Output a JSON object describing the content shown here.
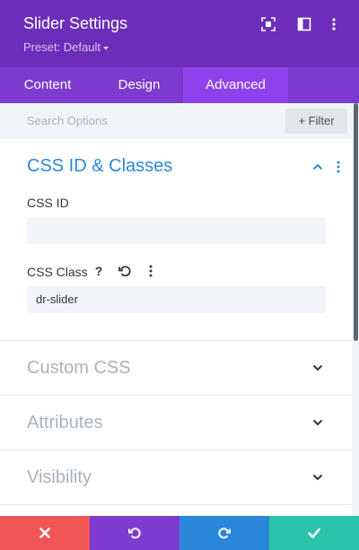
{
  "header": {
    "title": "Slider Settings",
    "preset": "Preset: Default",
    "icons": [
      "fullscreen-icon",
      "split-view-icon",
      "more-vertical-icon"
    ]
  },
  "tabs": [
    {
      "label": "Content",
      "active": false
    },
    {
      "label": "Design",
      "active": false
    },
    {
      "label": "Advanced",
      "active": true
    }
  ],
  "search": {
    "placeholder": "Search Options",
    "filter_label": "+ Filter"
  },
  "sections": {
    "css_id_classes": {
      "title": "CSS ID & Classes",
      "expanded": true,
      "fields": {
        "css_id": {
          "label": "CSS ID",
          "value": ""
        },
        "css_class": {
          "label": "CSS Class",
          "value": "dr-slider",
          "icons": [
            "help-icon",
            "reset-icon",
            "options-icon"
          ]
        }
      }
    },
    "custom_css": {
      "title": "Custom CSS",
      "expanded": false
    },
    "attributes": {
      "title": "Attributes",
      "expanded": false
    },
    "visibility": {
      "title": "Visibility",
      "expanded": false
    }
  },
  "footer": {
    "buttons": [
      {
        "name": "cancel",
        "icon": "close-icon",
        "color": "#ef5555"
      },
      {
        "name": "undo",
        "icon": "undo-icon",
        "color": "#7e3bd0"
      },
      {
        "name": "redo",
        "icon": "redo-icon",
        "color": "#2b87da"
      },
      {
        "name": "save",
        "icon": "check-icon",
        "color": "#29c4a9"
      }
    ]
  },
  "colors": {
    "header": "#6c2eb9",
    "tabs": "#7d3bcf",
    "active_tab": "#8f42ec",
    "accent": "#2b87da"
  }
}
